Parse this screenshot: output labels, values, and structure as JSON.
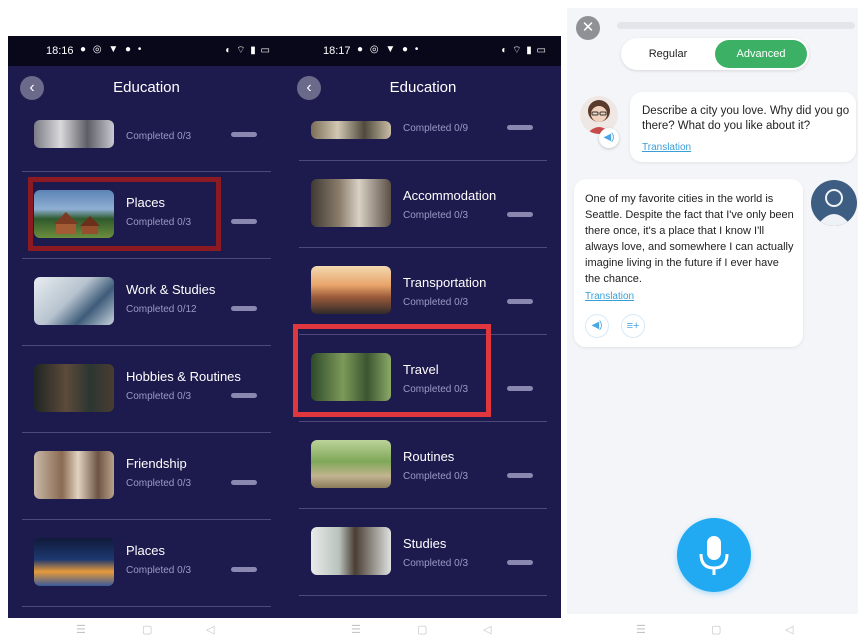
{
  "status_left": {
    "time": "18:16"
  },
  "status_right": {
    "time": "18:17"
  },
  "screen_left": {
    "title": "Education",
    "rows": [
      {
        "title": "",
        "sub": "Completed 0/3"
      },
      {
        "title": "Places",
        "sub": "Completed 0/3"
      },
      {
        "title": "Work & Studies",
        "sub": "Completed 0/12"
      },
      {
        "title": "Hobbies & Routines",
        "sub": "Completed 0/3"
      },
      {
        "title": "Friendship",
        "sub": "Completed 0/3"
      },
      {
        "title": "Places",
        "sub": "Completed 0/3"
      }
    ]
  },
  "screen_right": {
    "title": "Education",
    "rows": [
      {
        "title": "",
        "sub": "Completed 0/9"
      },
      {
        "title": "Accommodation",
        "sub": "Completed 0/3"
      },
      {
        "title": "Transportation",
        "sub": "Completed 0/3"
      },
      {
        "title": "Travel",
        "sub": "Completed 0/3"
      },
      {
        "title": "Routines",
        "sub": "Completed 0/3"
      },
      {
        "title": "Studies",
        "sub": "Completed 0/3"
      }
    ]
  },
  "chat": {
    "mode_regular": "Regular",
    "mode_advanced": "Advanced",
    "selected_mode": "Advanced",
    "prompt": "Describe a city you love. Why did you go there? What do you like about it?",
    "prompt_translation": "Translation",
    "answer": "One of my favorite cities in the world is Seattle. Despite the fact that I've only been there once, it's a place that I know I'll always love, and somewhere I can actually imagine living in the future if I ever have the chance.",
    "answer_translation": "Translation"
  },
  "colors": {
    "app_bg": "#1d1a4d",
    "highlight_dark": "#8c1a22",
    "highlight_bright": "#e0373f",
    "accent_green": "#3cb165",
    "accent_blue": "#21a9f2"
  },
  "icons": [
    "back-arrow-icon",
    "close-icon",
    "speaker-icon",
    "playlist-add-icon",
    "microphone-icon",
    "user-avatar-icon"
  ]
}
